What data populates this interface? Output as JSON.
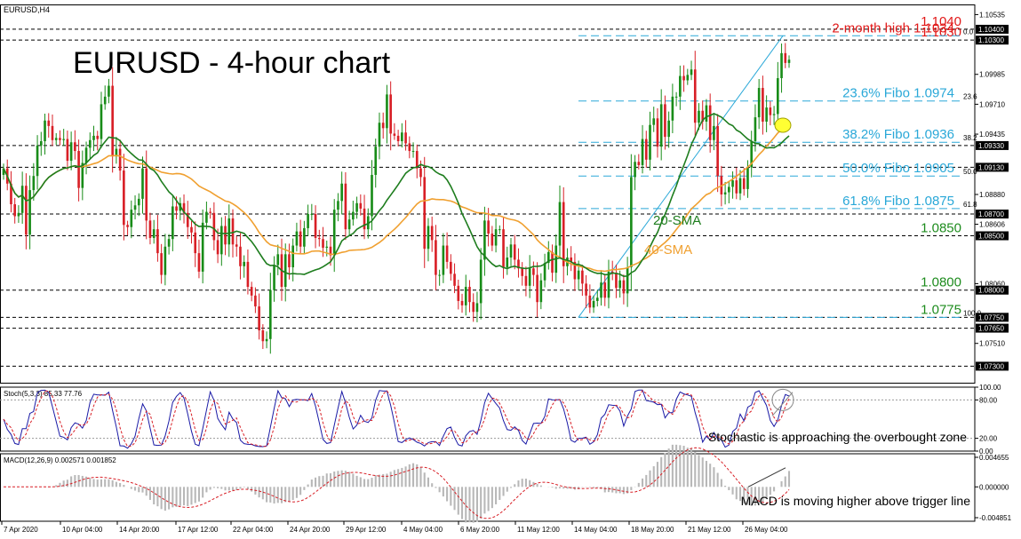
{
  "chart_data": {
    "type": "candlestick",
    "symbol": "EURUSD,H4",
    "title": "EURUSD - 4-hour chart",
    "price_axis": {
      "ylim": [
        1.0714,
        1.1062
      ],
      "ticks": [
        "1.10535",
        "1.09985",
        "1.09710",
        "1.09435",
        "1.08880",
        "1.08606",
        "1.08060",
        "1.07510"
      ],
      "ticks_values": [
        1.10535,
        1.09985,
        1.0971,
        1.09435,
        1.0888,
        1.08606,
        1.0806,
        1.0751
      ],
      "boxes": [
        {
          "label": "1.10400",
          "value": 1.104
        },
        {
          "label": "1.10300",
          "value": 1.103
        },
        {
          "label": "1.09330",
          "value": 1.0933
        },
        {
          "label": "1.09130",
          "value": 1.0913
        },
        {
          "label": "1.08700",
          "value": 1.087
        },
        {
          "label": "1.08500",
          "value": 1.085
        },
        {
          "label": "1.08000",
          "value": 1.08
        },
        {
          "label": "1.07750",
          "value": 1.0775
        },
        {
          "label": "1.07650",
          "value": 1.0765
        },
        {
          "label": "1.07300",
          "value": 1.073
        }
      ]
    },
    "x_axis_labels": [
      "7 Apr 2020",
      "10 Apr 04:00",
      "14 Apr 20:00",
      "17 Apr 12:00",
      "22 Apr 04:00",
      "24 Apr 20:00",
      "29 Apr 12:00",
      "4 May 04:00",
      "6 May 20:00",
      "11 May 12:00",
      "14 May 04:00",
      "18 May 20:00",
      "21 May 12:00",
      "26 May 04:00"
    ],
    "horizontal_levels": [
      {
        "value": 1.104,
        "label": "1.1040",
        "color": "#e11919"
      },
      {
        "value": 1.103,
        "label": "1.1030",
        "color": "#e11919"
      },
      {
        "value": 1.0933,
        "label": ""
      },
      {
        "value": 1.0913,
        "label": ""
      },
      {
        "value": 1.087,
        "label": ""
      },
      {
        "value": 1.085,
        "label": "1.0850",
        "color": "#1e8c1e"
      },
      {
        "value": 1.08,
        "label": "1.0800",
        "color": "#1e8c1e"
      },
      {
        "value": 1.0775,
        "label": "1.0775",
        "color": "#1e8c1e"
      },
      {
        "value": 1.0765,
        "label": ""
      },
      {
        "value": 1.073,
        "label": ""
      }
    ],
    "fibonacci": {
      "low": 1.0775,
      "high": 1.1034,
      "levels": [
        {
          "ratio": "0.0",
          "value": 1.1034,
          "label": "2-month high 1.1034",
          "color": "#e11919"
        },
        {
          "ratio": "23.6",
          "value": 1.0974,
          "label": "23.6% Fibo 1.0974",
          "color": "#2aa8d8"
        },
        {
          "ratio": "38.2",
          "value": 1.0936,
          "label": "38.2% Fibo 1.0936",
          "color": "#2aa8d8"
        },
        {
          "ratio": "50.0",
          "value": 1.0905,
          "label": "50.0% Fibo 1.0905",
          "color": "#2aa8d8"
        },
        {
          "ratio": "61.8",
          "value": 1.0875,
          "label": "61.8% Fibo 1.0875",
          "color": "#2aa8d8"
        },
        {
          "ratio": "100.0",
          "value": 1.0775,
          "label": "",
          "color": "#2aa8d8"
        }
      ]
    },
    "sma_labels": [
      {
        "name": "20-SMA",
        "color": "#1e7d1e"
      },
      {
        "name": "40-SMA",
        "color": "#f0a030"
      }
    ],
    "series": {
      "close": [
        1.0912,
        1.0898,
        1.0879,
        1.0868,
        1.0871,
        1.0896,
        1.0851,
        1.0892,
        1.0905,
        1.0933,
        1.0937,
        1.0956,
        1.0951,
        1.0938,
        1.094,
        1.0938,
        1.0939,
        1.0919,
        1.0936,
        1.0928,
        1.0894,
        1.0917,
        1.0931,
        1.0938,
        1.0942,
        1.0939,
        1.0971,
        1.0978,
        1.0988,
        1.0923,
        1.093,
        1.091,
        1.086,
        1.0858,
        1.0874,
        1.0878,
        1.0884,
        1.0912,
        1.0864,
        1.0848,
        1.0856,
        1.0834,
        1.0814,
        1.084,
        1.0847,
        1.0877,
        1.0873,
        1.088,
        1.0871,
        1.0858,
        1.0853,
        1.0834,
        1.0817,
        1.0862,
        1.0872,
        1.0871,
        1.0846,
        1.0833,
        1.0859,
        1.0842,
        1.0866,
        1.0842,
        1.084,
        1.0822,
        1.0826,
        1.0803,
        1.0795,
        1.0785,
        1.0763,
        1.0753,
        1.0755,
        1.08,
        1.0823,
        1.0833,
        1.0803,
        1.0833,
        1.0821,
        1.0841,
        1.0854,
        1.084,
        1.0857,
        1.087,
        1.087,
        1.0848,
        1.0847,
        1.0839,
        1.084,
        1.0832,
        1.0874,
        1.0882,
        1.0898,
        1.0856,
        1.0865,
        1.0872,
        1.088,
        1.0875,
        1.0856,
        1.0868,
        1.0906,
        1.0932,
        1.0954,
        1.0949,
        1.098,
        1.0944,
        1.0942,
        1.0937,
        1.0945,
        1.0935,
        1.0928,
        1.0928,
        1.0912,
        1.0904,
        1.0838,
        1.0859,
        1.0846,
        1.0814,
        1.0814,
        1.0841,
        1.0826,
        1.0815,
        1.0804,
        1.079,
        1.0786,
        1.0803,
        1.0789,
        1.078,
        1.0788,
        1.0828,
        1.0864,
        1.0852,
        1.0841,
        1.0856,
        1.0856,
        1.0821,
        1.083,
        1.0842,
        1.0828,
        1.082,
        1.0813,
        1.0804,
        1.082,
        1.0814,
        1.0789,
        1.0809,
        1.0825,
        1.0835,
        1.0816,
        1.0841,
        1.0881,
        1.0822,
        1.083,
        1.0826,
        1.081,
        1.0818,
        1.0806,
        1.0795,
        1.0784,
        1.079,
        1.0793,
        1.0807,
        1.0793,
        1.0817,
        1.0816,
        1.0802,
        1.0809,
        1.0797,
        1.0821,
        1.0904,
        1.0918,
        1.0915,
        1.0939,
        1.092,
        1.0952,
        1.0958,
        1.0932,
        1.0971,
        1.0941,
        1.0956,
        1.0978,
        1.0978,
        1.0997,
        1.0993,
        1.0998,
        1.1003,
        1.0954,
        1.0965,
        1.0955,
        1.097,
        1.0938,
        1.0951,
        1.0905,
        1.0888,
        1.089,
        1.0895,
        1.0901,
        1.0889,
        1.0903,
        1.0893,
        1.0913,
        1.0937,
        1.0959,
        1.0986,
        1.0955,
        1.0968,
        1.0961,
        1.0962,
        1.0995,
        1.1018,
        1.1009,
        1.1012
      ]
    },
    "stochastic": {
      "label": "Stoch(5,3,3) 85.33 77.76",
      "ylim": [
        0,
        100
      ],
      "ticks": [
        "100.00",
        "80.00",
        "20.00",
        "0.00"
      ],
      "ticks_values": [
        100,
        80,
        20,
        0
      ],
      "annotation": "Stochastic is approaching the overbought zone"
    },
    "macd": {
      "label": "MACD(12,26,9) 0.002571 0.001852",
      "ticks": [
        "0.004655",
        "0.000000",
        "-0.004851"
      ],
      "ticks_values": [
        0.004655,
        0.0,
        -0.004851
      ],
      "annotation": "MACD is moving higher above trigger line"
    }
  }
}
